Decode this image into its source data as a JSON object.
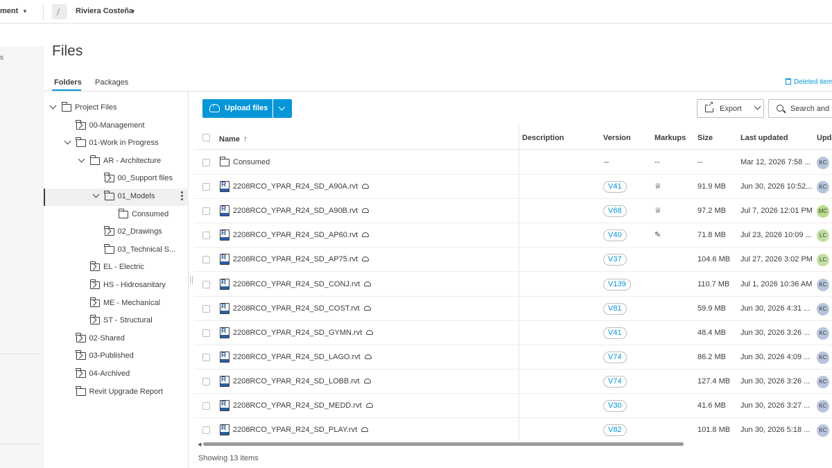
{
  "topbar": {
    "module_label": "ment",
    "project_name": "Riviera Costeña"
  },
  "leftnav": {
    "partial_label": "s"
  },
  "page": {
    "title": "Files"
  },
  "tabs": [
    {
      "label": "Folders",
      "active": true
    },
    {
      "label": "Packages",
      "active": false
    }
  ],
  "deleted_items_label": "Deleted item",
  "tree": [
    {
      "label": "Project Files",
      "level": 0,
      "expander": "down"
    },
    {
      "label": "00-Management",
      "level": 1,
      "expander": "right"
    },
    {
      "label": "01-Work in Progress",
      "level": 1,
      "expander": "down"
    },
    {
      "label": "AR - Architecture",
      "level": 2,
      "expander": "down"
    },
    {
      "label": "00_Support files",
      "level": 3,
      "expander": "right"
    },
    {
      "label": "01_Models",
      "level": 3,
      "expander": "down",
      "selected": true
    },
    {
      "label": "Consumed",
      "level": 4,
      "expander": "none"
    },
    {
      "label": "02_Drawings",
      "level": 3,
      "expander": "right"
    },
    {
      "label": "03_Technical S...",
      "level": 3,
      "expander": "none"
    },
    {
      "label": "EL - Electric",
      "level": 2,
      "expander": "right"
    },
    {
      "label": "HS - Hidrosanitary",
      "level": 2,
      "expander": "right"
    },
    {
      "label": "ME - Mechanical",
      "level": 2,
      "expander": "right"
    },
    {
      "label": "ST - Structural",
      "level": 2,
      "expander": "right"
    },
    {
      "label": "02-Shared",
      "level": 1,
      "expander": "right"
    },
    {
      "label": "03-Published",
      "level": 1,
      "expander": "right"
    },
    {
      "label": "04-Archived",
      "level": 1,
      "expander": "right"
    },
    {
      "label": "Revit Upgrade Report",
      "level": 1,
      "expander": "none"
    }
  ],
  "toolbar": {
    "upload_label": "Upload files",
    "export_label": "Export",
    "search_label": "Search and f"
  },
  "columns": {
    "name": "Name",
    "description": "Description",
    "version": "Version",
    "markups": "Markups",
    "size": "Size",
    "last_updated": "Last updated",
    "updated_by": "Upda"
  },
  "rows": [
    {
      "type": "folder",
      "name": "Consumed",
      "version": "--",
      "markups": "--",
      "size": "--",
      "updated": "Mar 12, 2026 7:58 ...",
      "user": "KC",
      "user_color": "#b7c4dc"
    },
    {
      "type": "rvt",
      "name": "2208RCO_YPAR_R24_SD_A90A.rvt",
      "version": "V41",
      "markups": "crown-icon",
      "size": "91.9 MB",
      "updated": "Jun 30, 2026 10:52...",
      "user": "KC",
      "user_color": "#b7c4dc"
    },
    {
      "type": "rvt",
      "name": "2208RCO_YPAR_R24_SD_A90B.rvt",
      "version": "V68",
      "markups": "crown-icon",
      "size": "97.2 MB",
      "updated": "Jul 7, 2026 12:01 PM",
      "user": "MC",
      "user_color": "#b9dc8a"
    },
    {
      "type": "rvt",
      "name": "2208RCO_YPAR_R24_SD_AP60.rvt",
      "version": "V40",
      "markups": "pen-icon",
      "size": "71.8 MB",
      "updated": "Jul 23, 2026 10:09 ...",
      "user": "LC",
      "user_color": "#c4dfa0"
    },
    {
      "type": "rvt",
      "name": "2208RCO_YPAR_R24_SD_AP75.rvt",
      "version": "V37",
      "markups": "",
      "size": "104.6 MB",
      "updated": "Jul 27, 2026 3:02 PM",
      "user": "LC",
      "user_color": "#c4dfa0"
    },
    {
      "type": "rvt",
      "name": "2208RCO_YPAR_R24_SD_CONJ.rvt",
      "version": "V139",
      "markups": "",
      "size": "110.7 MB",
      "updated": "Jul 1, 2026 10:36 AM",
      "user": "KC",
      "user_color": "#b7c4dc"
    },
    {
      "type": "rvt",
      "name": "2208RCO_YPAR_R24_SD_COST.rvt",
      "version": "V81",
      "markups": "",
      "size": "59.9 MB",
      "updated": "Jun 30, 2026 4:31 ...",
      "user": "KC",
      "user_color": "#b7c4dc"
    },
    {
      "type": "rvt",
      "name": "2208RCO_YPAR_R24_SD_GYMN.rvt",
      "version": "V41",
      "markups": "",
      "size": "48.4 MB",
      "updated": "Jun 30, 2026 3:26 ...",
      "user": "KC",
      "user_color": "#b7c4dc"
    },
    {
      "type": "rvt",
      "name": "2208RCO_YPAR_R24_SD_LAGO.rvt",
      "version": "V74",
      "markups": "",
      "size": "86.2 MB",
      "updated": "Jun 30, 2026 4:09 ...",
      "user": "KC",
      "user_color": "#b7c4dc"
    },
    {
      "type": "rvt",
      "name": "2208RCO_YPAR_R24_SD_LOBB.rvt",
      "version": "V74",
      "markups": "",
      "size": "127.4 MB",
      "updated": "Jun 30, 2026 3:26 ...",
      "user": "KC",
      "user_color": "#b7c4dc"
    },
    {
      "type": "rvt",
      "name": "2208RCO_YPAR_R24_SD_MEDD.rvt",
      "version": "V30",
      "markups": "",
      "size": "41.6 MB",
      "updated": "Jun 30, 2026 3:27 ...",
      "user": "KC",
      "user_color": "#b7c4dc"
    },
    {
      "type": "rvt",
      "name": "2208RCO_YPAR_R24_SD_PLAY.rvt",
      "version": "V82",
      "markups": "",
      "size": "101.8 MB",
      "updated": "Jun 30, 2026 5:18 ...",
      "user": "KC",
      "user_color": "#b7c4dc"
    }
  ],
  "footer": {
    "count_label": "Showing 13 items"
  },
  "colors": {
    "accent": "#0696d7",
    "text": "#3c3c3c"
  }
}
